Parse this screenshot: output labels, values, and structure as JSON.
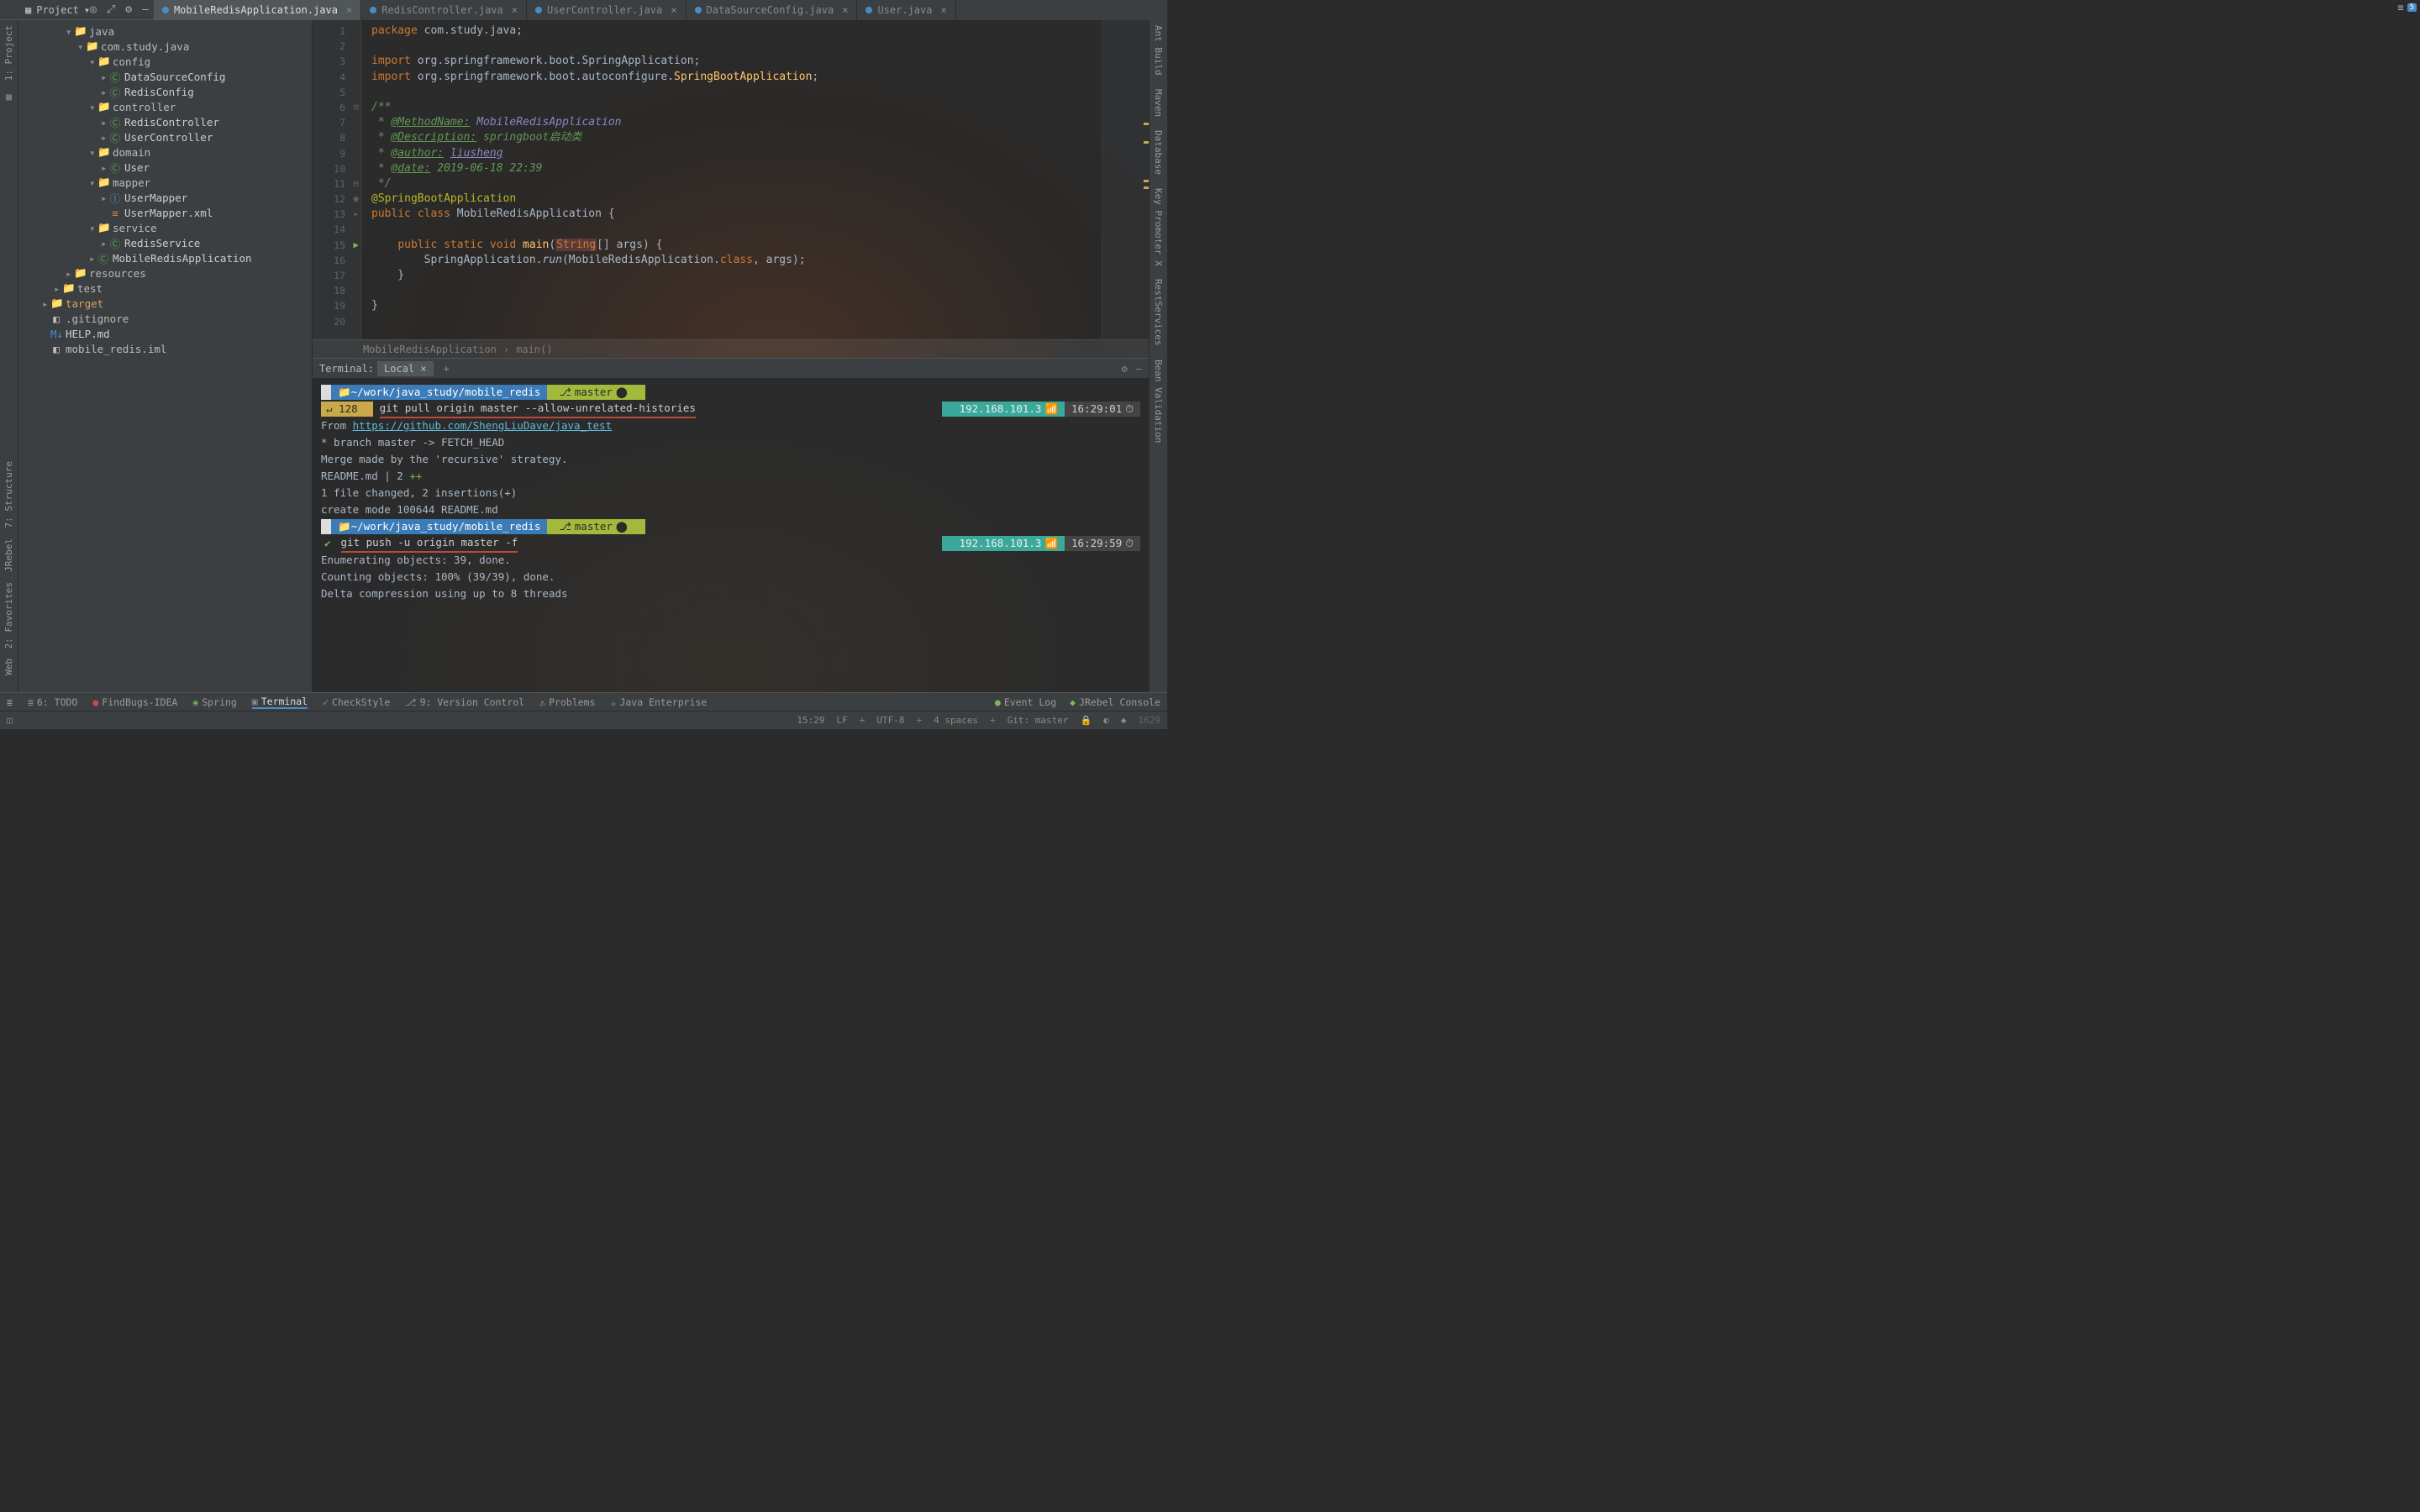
{
  "header": {
    "project_label": "Project",
    "tabs": [
      {
        "label": "MobileRedisApplication.java",
        "active": true
      },
      {
        "label": "RedisController.java",
        "active": false
      },
      {
        "label": "UserController.java",
        "active": false
      },
      {
        "label": "DataSourceConfig.java",
        "active": false
      },
      {
        "label": "User.java",
        "active": false
      }
    ],
    "tab_badge": "5"
  },
  "sidebar": {
    "tool_labels": {
      "project": "1: Project",
      "structure": "7: Structure",
      "jrebel": "JRebel",
      "favorites": "2: Favorites",
      "web": "Web"
    },
    "tree": [
      {
        "indent": 4,
        "arrow": "▾",
        "icon": "📁",
        "label": "java",
        "cls": "folder"
      },
      {
        "indent": 5,
        "arrow": "▾",
        "icon": "📁",
        "label": "com.study.java",
        "cls": "folder"
      },
      {
        "indent": 6,
        "arrow": "▾",
        "icon": "📁",
        "label": "config",
        "cls": "folder"
      },
      {
        "indent": 7,
        "arrow": "▸",
        "icon": "Ⓒ",
        "label": "DataSourceConfig",
        "cls": "java-class"
      },
      {
        "indent": 7,
        "arrow": "▸",
        "icon": "Ⓒ",
        "label": "RedisConfig",
        "cls": "java-class"
      },
      {
        "indent": 6,
        "arrow": "▾",
        "icon": "📁",
        "label": "controller",
        "cls": "folder"
      },
      {
        "indent": 7,
        "arrow": "▸",
        "icon": "Ⓒ",
        "label": "RedisController",
        "cls": "java-class"
      },
      {
        "indent": 7,
        "arrow": "▸",
        "icon": "Ⓒ",
        "label": "UserController",
        "cls": "java-class"
      },
      {
        "indent": 6,
        "arrow": "▾",
        "icon": "📁",
        "label": "domain",
        "cls": "folder"
      },
      {
        "indent": 7,
        "arrow": "▸",
        "icon": "Ⓒ",
        "label": "User",
        "cls": "java-class"
      },
      {
        "indent": 6,
        "arrow": "▾",
        "icon": "📁",
        "label": "mapper",
        "cls": "folder"
      },
      {
        "indent": 7,
        "arrow": "▸",
        "icon": "Ⓘ",
        "label": "UserMapper",
        "cls": "interface"
      },
      {
        "indent": 7,
        "arrow": "",
        "icon": "≡",
        "label": "UserMapper.xml",
        "cls": "xml"
      },
      {
        "indent": 6,
        "arrow": "▾",
        "icon": "📁",
        "label": "service",
        "cls": "folder"
      },
      {
        "indent": 7,
        "arrow": "▸",
        "icon": "Ⓒ",
        "label": "RedisService",
        "cls": "java-class"
      },
      {
        "indent": 6,
        "arrow": "▸",
        "icon": "Ⓒ",
        "label": "MobileRedisApplication",
        "cls": "java-class"
      },
      {
        "indent": 4,
        "arrow": "▸",
        "icon": "📁",
        "label": "resources",
        "cls": "folder"
      },
      {
        "indent": 3,
        "arrow": "▸",
        "icon": "📁",
        "label": "test",
        "cls": "folder"
      },
      {
        "indent": 2,
        "arrow": "▸",
        "icon": "📁",
        "label": "target",
        "cls": "special-folder"
      },
      {
        "indent": 2,
        "arrow": "",
        "icon": "◧",
        "label": ".gitignore",
        "cls": "folder"
      },
      {
        "indent": 2,
        "arrow": "",
        "icon": "M↓",
        "label": "HELP.md",
        "cls": "interface"
      },
      {
        "indent": 2,
        "arrow": "",
        "icon": "◧",
        "label": "mobile_redis.iml",
        "cls": "folder"
      }
    ]
  },
  "right_tools": [
    "Ant Build",
    "Maven",
    "Database",
    "Key Promoter X",
    "RestServices",
    "Bean Validation"
  ],
  "editor": {
    "lines": [
      {
        "n": 1,
        "html": "<span class='kw'>package</span> com.study.java;"
      },
      {
        "n": 2,
        "html": ""
      },
      {
        "n": 3,
        "html": "<span class='kw'>import</span> org.springframework.boot.SpringApplication;"
      },
      {
        "n": 4,
        "html": "<span class='kw'>import</span> org.springframework.boot.autoconfigure.<span class='method-call'>SpringBootApplication</span>;"
      },
      {
        "n": 5,
        "html": ""
      },
      {
        "n": 6,
        "html": "<span class='doc'>/**</span>",
        "mark": "⊟"
      },
      {
        "n": 7,
        "html": "<span class='doc'> * </span><span class='doc-tag'>@MethodName:</span> <span class='doc-val'>MobileRedisApplication</span>"
      },
      {
        "n": 8,
        "html": "<span class='doc'> * </span><span class='doc-tag'>@Description:</span> <span class='doc'>springboot启动类</span>"
      },
      {
        "n": 9,
        "html": "<span class='doc'> * </span><span class='doc-tag'>@author:</span> <span class='doc-val'><u>liusheng</u></span>"
      },
      {
        "n": 10,
        "html": "<span class='doc'> * </span><span class='doc-tag'>@date:</span> <span class='doc'>2019-06-18 22:39</span>"
      },
      {
        "n": 11,
        "html": "<span class='doc'> */</span>",
        "mark": "⊟"
      },
      {
        "n": 12,
        "html": "<span class='annot'>@SpringBootApplication</span>",
        "mark": "◉"
      },
      {
        "n": 13,
        "html": "<span class='kw'>public</span> <span class='kw'>class</span> MobileRedisApplication {",
        "mark": "▸"
      },
      {
        "n": 14,
        "html": ""
      },
      {
        "n": 15,
        "html": "    <span class='kw'>public</span> <span class='kw'>static</span> <span class='kw'>void</span> <span class='method-call'>main</span>(<span class='hl-string'>String</span>[] args) {",
        "mark": "▶"
      },
      {
        "n": 16,
        "html": "        SpringApplication.<span class='static-call'>run</span>(MobileRedisApplication.<span class='kw'>class</span>, args);"
      },
      {
        "n": 17,
        "html": "    }"
      },
      {
        "n": 18,
        "html": ""
      },
      {
        "n": 19,
        "html": "}"
      },
      {
        "n": 20,
        "html": ""
      }
    ],
    "breadcrumb": [
      "MobileRedisApplication",
      "main()"
    ]
  },
  "terminal": {
    "title": "Terminal:",
    "tab": "Local",
    "prompt_path": "~/work/java_study/mobile_redis",
    "branch": "master",
    "exit_code": "↵ 128",
    "cmd1": "git pull origin master --allow-unrelated-histories",
    "ip": "192.168.101.3",
    "time1": "16:29:01",
    "output": [
      "",
      "From https://github.com/ShengLiuDave/java_test",
      " * branch            master     -> FETCH_HEAD",
      "Merge made by the 'recursive' strategy.",
      " README.md | 2 ++",
      " 1 file changed, 2 insertions(+)",
      " create mode 100644 README.md",
      ""
    ],
    "cmd2": "git push -u origin master -f",
    "time2": "16:29:59",
    "output2": [
      "",
      "Enumerating objects: 39, done.",
      "Counting objects: 100% (39/39), done.",
      "Delta compression using up to 8 threads"
    ]
  },
  "bottom_tools": [
    {
      "icon": "≣",
      "label": "6: TODO"
    },
    {
      "icon": "●",
      "label": "FindBugs-IDEA",
      "color": "#c94a4a"
    },
    {
      "icon": "❀",
      "label": "Spring",
      "color": "#7ab85c"
    },
    {
      "icon": "▣",
      "label": "Terminal",
      "active": true
    },
    {
      "icon": "✓",
      "label": "CheckStyle"
    },
    {
      "icon": "⎇",
      "label": "9: Version Control"
    },
    {
      "icon": "⚠",
      "label": "Problems",
      "color": "#c9a94a"
    },
    {
      "icon": "☕",
      "label": "Java Enterprise"
    }
  ],
  "bottom_right": [
    {
      "icon": "●",
      "label": "Event Log",
      "color": "#7ab85c"
    },
    {
      "icon": "◆",
      "label": "JRebel Console",
      "color": "#7ab85c"
    }
  ],
  "status": {
    "pos": "15:29",
    "lf": "LF",
    "enc": "UTF-8",
    "indent": "4 spaces",
    "git": "Git: master",
    "right_note": "1629"
  }
}
